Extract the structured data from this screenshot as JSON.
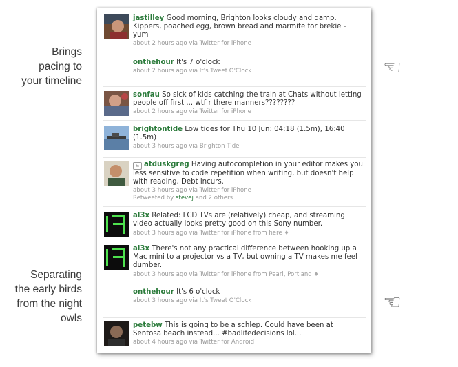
{
  "annotations": {
    "top_lines": [
      "Brings",
      "pacing to",
      "your timeline"
    ],
    "bottom_lines": [
      "Separating",
      "the early birds",
      "from the night",
      "owls"
    ]
  },
  "pointer_glyph": "☜",
  "tweets": [
    {
      "user": "jastilley",
      "text": "Good morning, Brighton looks cloudy and damp. Kippers, poached egg, brown bread and marmite for brekie - yum",
      "meta": "about 2 hours ago via Twitter for iPhone",
      "avatar": "photo-person-icon"
    },
    {
      "user": "onthehour",
      "text": "It's 7 o'clock",
      "meta": "about 2 hours ago via It's Tweet O'Clock",
      "avatar": ""
    },
    {
      "user": "sonfau",
      "text": "So sick of kids catching the train at Chats without letting people off first ... wtf r there manners????????",
      "meta": "about 2 hours ago via Twitter for iPhone",
      "avatar": "photo-person-icon"
    },
    {
      "user": "brightontide",
      "text": "Low tides for Thu 10 Jun: 04:18 (1.5m), 16:40 (1.5m)",
      "meta": "about 3 hours ago via Brighton Tide",
      "avatar": "pier-photo-icon"
    },
    {
      "user": "atduskgreg",
      "text": "Having autocompletion in your editor makes you less sensitive to code repetition when writing, but doesn't help with reading. Debt incurs.",
      "meta": "about 3 hours ago via Twitter for iPhone",
      "retweet_prefix": "Retweeted by",
      "retweet_user": "stevej",
      "retweet_suffix": "and 2 others",
      "avatar": "photo-person-icon"
    },
    {
      "user": "al3x",
      "text": "Related: LCD TVs are (relatively) cheap, and streaming video actually looks pretty good on this Sony number.",
      "meta": "about 3 hours ago via Twitter for iPhone from here",
      "avatar": "lcd-digit-icon"
    },
    {
      "user": "al3x",
      "text": "There's not any practical difference between hooking up a Mac mini to a projector vs a TV, but owning a TV makes me feel dumber.",
      "meta": "about 3 hours ago via Twitter for iPhone from Pearl, Portland",
      "avatar": "lcd-digit-icon"
    },
    {
      "user": "onthehour",
      "text": "It's 6 o'clock",
      "meta": "about 3 hours ago via It's Tweet O'Clock",
      "avatar": ""
    },
    {
      "user": "petebw",
      "text": "This is going to be a schlep. Could have been at Sentosa beach instead... #badlifedecisions lol...",
      "meta": "about 4 hours ago via Twitter for Android",
      "avatar": "photo-person-icon"
    }
  ]
}
